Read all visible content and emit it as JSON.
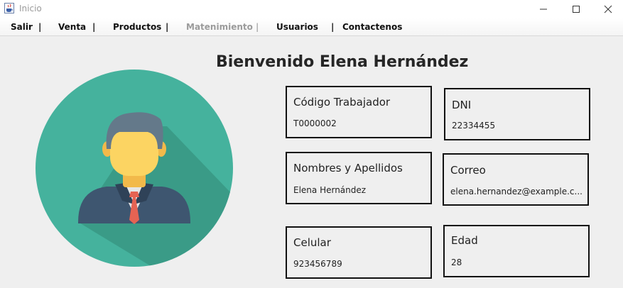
{
  "window": {
    "title": "Inicio",
    "icon": "java-cup-icon"
  },
  "menu": {
    "items": [
      {
        "label": "Salir",
        "enabled": true
      },
      {
        "label": "Venta",
        "enabled": true
      },
      {
        "label": "Productos",
        "enabled": true
      },
      {
        "label": "Matenimiento",
        "enabled": false
      },
      {
        "label": "Usuarios",
        "enabled": true
      },
      {
        "label": "Contactenos",
        "enabled": true
      }
    ],
    "separator": "|"
  },
  "welcome": "Bienvenido Elena Hernández",
  "avatar": {
    "icon": "businessman-avatar-icon",
    "bg_color": "#45b29d"
  },
  "fields": {
    "codigo": {
      "label": "Código Trabajador",
      "value": "T0000002"
    },
    "dni": {
      "label": "DNI",
      "value": "22334455"
    },
    "nombres": {
      "label": "Nombres y Apellidos",
      "value": "Elena Hernández"
    },
    "correo": {
      "label": "Correo",
      "value": "elena.hernandez@example.c..."
    },
    "celular": {
      "label": "Celular",
      "value": "923456789"
    },
    "edad": {
      "label": "Edad",
      "value": "28"
    }
  }
}
